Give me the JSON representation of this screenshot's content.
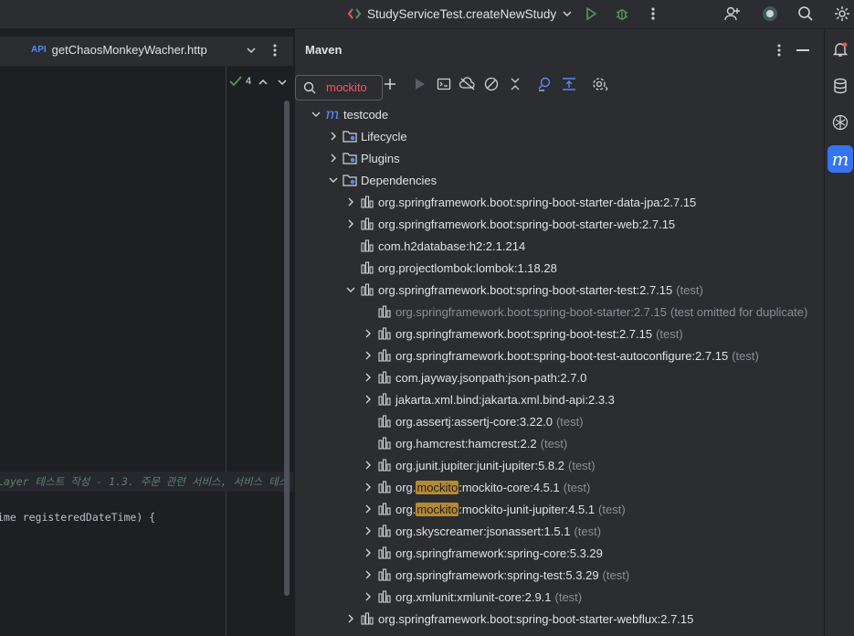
{
  "topbar": {
    "run_config": "StudyServiceTest.createNewStudy"
  },
  "editor": {
    "tab_type": "API",
    "tab_label": "getChaosMonkeyWacher.http",
    "problems_count": "4",
    "comment_line": "Layer 테스트 작성 - 1.3. 주문 관련 서비스, 서비스 테스",
    "code_line": "ime registeredDateTime) {"
  },
  "maven": {
    "title": "Maven",
    "search_value": "mockito",
    "tree": [
      {
        "label": "testcode",
        "scope": ""
      },
      {
        "label": "Lifecycle",
        "scope": ""
      },
      {
        "label": "Plugins",
        "scope": ""
      },
      {
        "label": "Dependencies",
        "scope": ""
      },
      {
        "label": "org.springframework.boot:spring-boot-starter-data-jpa:2.7.15",
        "scope": ""
      },
      {
        "label": "org.springframework.boot:spring-boot-starter-web:2.7.15",
        "scope": ""
      },
      {
        "label": "com.h2database:h2:2.1.214",
        "scope": ""
      },
      {
        "label": "org.projectlombok:lombok:1.18.28",
        "scope": ""
      },
      {
        "label": "org.springframework.boot:spring-boot-starter-test:2.7.15",
        "scope": "(test)"
      },
      {
        "label": "org.springframework.boot:spring-boot-starter:2.7.15",
        "scope": "(test omitted for duplicate)"
      },
      {
        "label": "org.springframework.boot:spring-boot-test:2.7.15",
        "scope": "(test)"
      },
      {
        "label": "org.springframework.boot:spring-boot-test-autoconfigure:2.7.15",
        "scope": "(test)"
      },
      {
        "label": "com.jayway.jsonpath:json-path:2.7.0",
        "scope": ""
      },
      {
        "label": "jakarta.xml.bind:jakarta.xml.bind-api:2.3.3",
        "scope": ""
      },
      {
        "label": "org.assertj:assertj-core:3.22.0",
        "scope": "(test)"
      },
      {
        "label": "org.hamcrest:hamcrest:2.2",
        "scope": "(test)"
      },
      {
        "label": "org.junit.jupiter:junit-jupiter:5.8.2",
        "scope": "(test)"
      },
      {
        "prefix": "org.",
        "match": "mockito",
        "suffix": ":mockito-core:4.5.1",
        "scope": "(test)"
      },
      {
        "prefix": "org.",
        "match": "mockito",
        "suffix": ":mockito-junit-jupiter:4.5.1",
        "scope": "(test)"
      },
      {
        "label": "org.skyscreamer:jsonassert:1.5.1",
        "scope": "(test)"
      },
      {
        "label": "org.springframework:spring-core:5.3.29",
        "scope": ""
      },
      {
        "label": "org.springframework:spring-test:5.3.29",
        "scope": "(test)"
      },
      {
        "label": "org.xmlunit:xmlunit-core:2.9.1",
        "scope": "(test)"
      },
      {
        "label": "org.springframework.boot:spring-boot-starter-webflux:2.7.15",
        "scope": ""
      }
    ]
  },
  "colors": {
    "accent": "#3574f0",
    "search_match": "#b48a32",
    "run_green": "#57965c",
    "search_text": "#f75464"
  },
  "icons": [
    "run-config-icon",
    "chevron-down-icon",
    "run-icon",
    "debug-icon",
    "more-icon",
    "add-user-icon",
    "ai-assistant-icon",
    "search-icon",
    "settings-icon",
    "notifications-icon",
    "database-icon",
    "graphql-icon",
    "maven-icon"
  ]
}
